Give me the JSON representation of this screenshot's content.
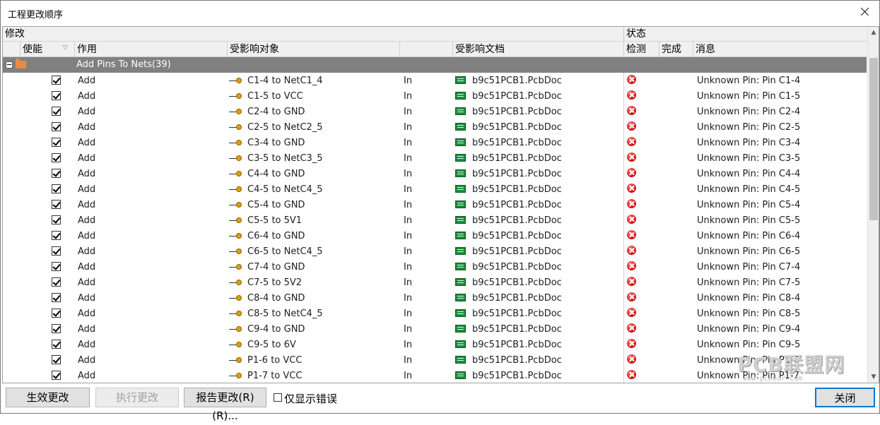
{
  "window": {
    "title": "工程更改顺序"
  },
  "header": {
    "group_modify": "修改",
    "group_status": "状态",
    "col_enable": "使能",
    "col_action": "作用",
    "col_object": "受影响对象",
    "col_document": "受影响文档",
    "col_check": "检测",
    "col_done": "完成",
    "col_message": "消息"
  },
  "group": {
    "label": "Add Pins To Nets(39)"
  },
  "rows": [
    {
      "action": "Add",
      "object": "C1-4 to NetC1_4",
      "in": "In",
      "doc": "b9c51PCB1.PcbDoc",
      "msg": "Unknown Pin: Pin C1-4"
    },
    {
      "action": "Add",
      "object": "C1-5 to VCC",
      "in": "In",
      "doc": "b9c51PCB1.PcbDoc",
      "msg": "Unknown Pin: Pin C1-5"
    },
    {
      "action": "Add",
      "object": "C2-4 to GND",
      "in": "In",
      "doc": "b9c51PCB1.PcbDoc",
      "msg": "Unknown Pin: Pin C2-4"
    },
    {
      "action": "Add",
      "object": "C2-5 to NetC2_5",
      "in": "In",
      "doc": "b9c51PCB1.PcbDoc",
      "msg": "Unknown Pin: Pin C2-5"
    },
    {
      "action": "Add",
      "object": "C3-4 to GND",
      "in": "In",
      "doc": "b9c51PCB1.PcbDoc",
      "msg": "Unknown Pin: Pin C3-4"
    },
    {
      "action": "Add",
      "object": "C3-5 to NetC3_5",
      "in": "In",
      "doc": "b9c51PCB1.PcbDoc",
      "msg": "Unknown Pin: Pin C3-5"
    },
    {
      "action": "Add",
      "object": "C4-4 to GND",
      "in": "In",
      "doc": "b9c51PCB1.PcbDoc",
      "msg": "Unknown Pin: Pin C4-4"
    },
    {
      "action": "Add",
      "object": "C4-5 to NetC4_5",
      "in": "In",
      "doc": "b9c51PCB1.PcbDoc",
      "msg": "Unknown Pin: Pin C4-5"
    },
    {
      "action": "Add",
      "object": "C5-4 to GND",
      "in": "In",
      "doc": "b9c51PCB1.PcbDoc",
      "msg": "Unknown Pin: Pin C5-4"
    },
    {
      "action": "Add",
      "object": "C5-5 to 5V1",
      "in": "In",
      "doc": "b9c51PCB1.PcbDoc",
      "msg": "Unknown Pin: Pin C5-5"
    },
    {
      "action": "Add",
      "object": "C6-4 to GND",
      "in": "In",
      "doc": "b9c51PCB1.PcbDoc",
      "msg": "Unknown Pin: Pin C6-4"
    },
    {
      "action": "Add",
      "object": "C6-5 to NetC4_5",
      "in": "In",
      "doc": "b9c51PCB1.PcbDoc",
      "msg": "Unknown Pin: Pin C6-5"
    },
    {
      "action": "Add",
      "object": "C7-4 to GND",
      "in": "In",
      "doc": "b9c51PCB1.PcbDoc",
      "msg": "Unknown Pin: Pin C7-4"
    },
    {
      "action": "Add",
      "object": "C7-5 to 5V2",
      "in": "In",
      "doc": "b9c51PCB1.PcbDoc",
      "msg": "Unknown Pin: Pin C7-5"
    },
    {
      "action": "Add",
      "object": "C8-4 to GND",
      "in": "In",
      "doc": "b9c51PCB1.PcbDoc",
      "msg": "Unknown Pin: Pin C8-4"
    },
    {
      "action": "Add",
      "object": "C8-5 to NetC4_5",
      "in": "In",
      "doc": "b9c51PCB1.PcbDoc",
      "msg": "Unknown Pin: Pin C8-5"
    },
    {
      "action": "Add",
      "object": "C9-4 to GND",
      "in": "In",
      "doc": "b9c51PCB1.PcbDoc",
      "msg": "Unknown Pin: Pin C9-4"
    },
    {
      "action": "Add",
      "object": "C9-5 to 6V",
      "in": "In",
      "doc": "b9c51PCB1.PcbDoc",
      "msg": "Unknown Pin: Pin C9-5"
    },
    {
      "action": "Add",
      "object": "P1-6 to VCC",
      "in": "In",
      "doc": "b9c51PCB1.PcbDoc",
      "msg": "Unknown Pin: Pin P1-6"
    },
    {
      "action": "Add",
      "object": "P1-7 to VCC",
      "in": "In",
      "doc": "b9c51PCB1.PcbDoc",
      "msg": "Unknown Pin: Pin P1-7"
    }
  ],
  "footer": {
    "validate_label": "生效更改",
    "execute_label": "执行更改",
    "report_label": "报告更改(R) (R)...",
    "only_errors_label": "仅显示错误",
    "close_label": "关闭"
  },
  "watermark": {
    "text": "PCB联盟网",
    "url": "www.pcbbar.com"
  },
  "colors": {
    "group_row_bg": "#808080",
    "error_icon": "#d11a1a",
    "primary_border": "#0078d7"
  }
}
